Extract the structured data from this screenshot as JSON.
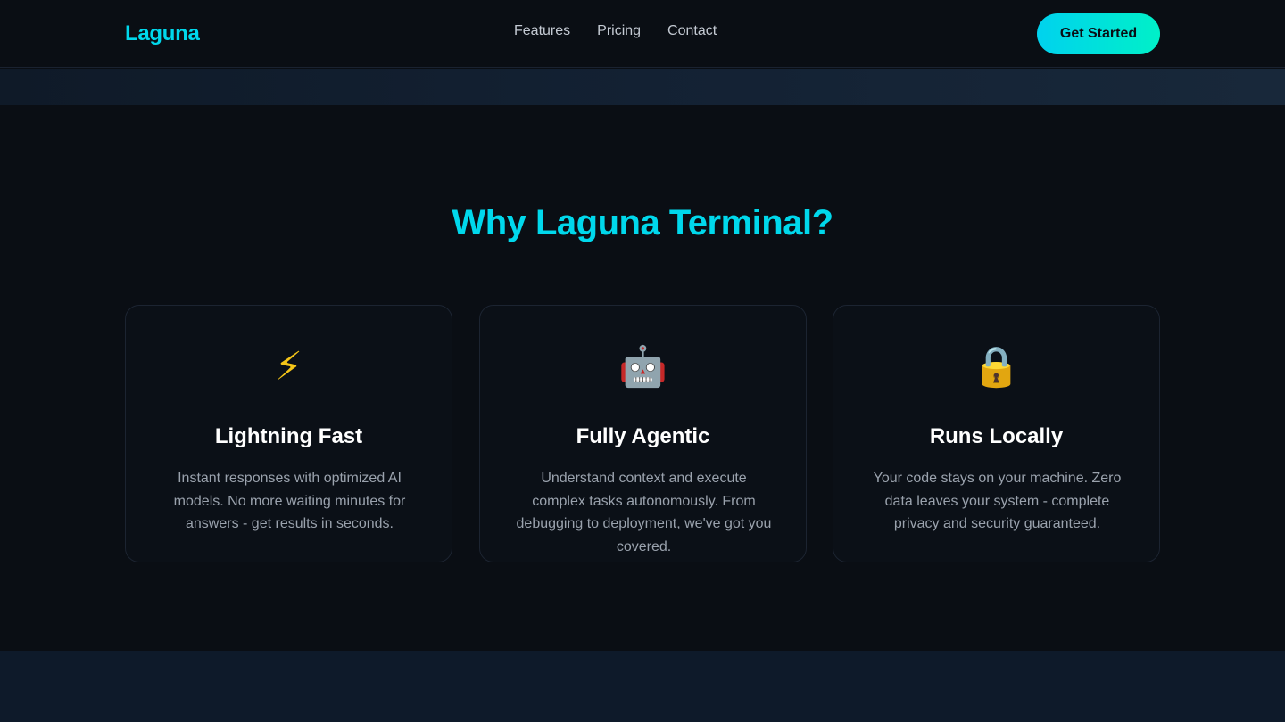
{
  "nav": {
    "logo": "Laguna",
    "links": [
      "Features",
      "Pricing",
      "Contact"
    ],
    "cta": "Get Started"
  },
  "features": {
    "title": "Why Laguna Terminal?",
    "cards": [
      {
        "icon": "⚡",
        "icon_name": "lightning-icon",
        "title": "Lightning Fast",
        "desc": "Instant responses with optimized AI models. No more waiting minutes for answers - get results in seconds."
      },
      {
        "icon": "🤖",
        "icon_name": "robot-icon",
        "title": "Fully Agentic",
        "desc": "Understand context and execute complex tasks autonomously. From debugging to deployment, we've got you covered."
      },
      {
        "icon": "🔒",
        "icon_name": "lock-icon",
        "title": "Runs Locally",
        "desc": "Your code stays on your machine. Zero data leaves your system - complete privacy and security guaranteed."
      }
    ]
  },
  "colors": {
    "accent": "#00d8ec",
    "accent_end": "#00f0c8",
    "background": "#0a0e14"
  }
}
